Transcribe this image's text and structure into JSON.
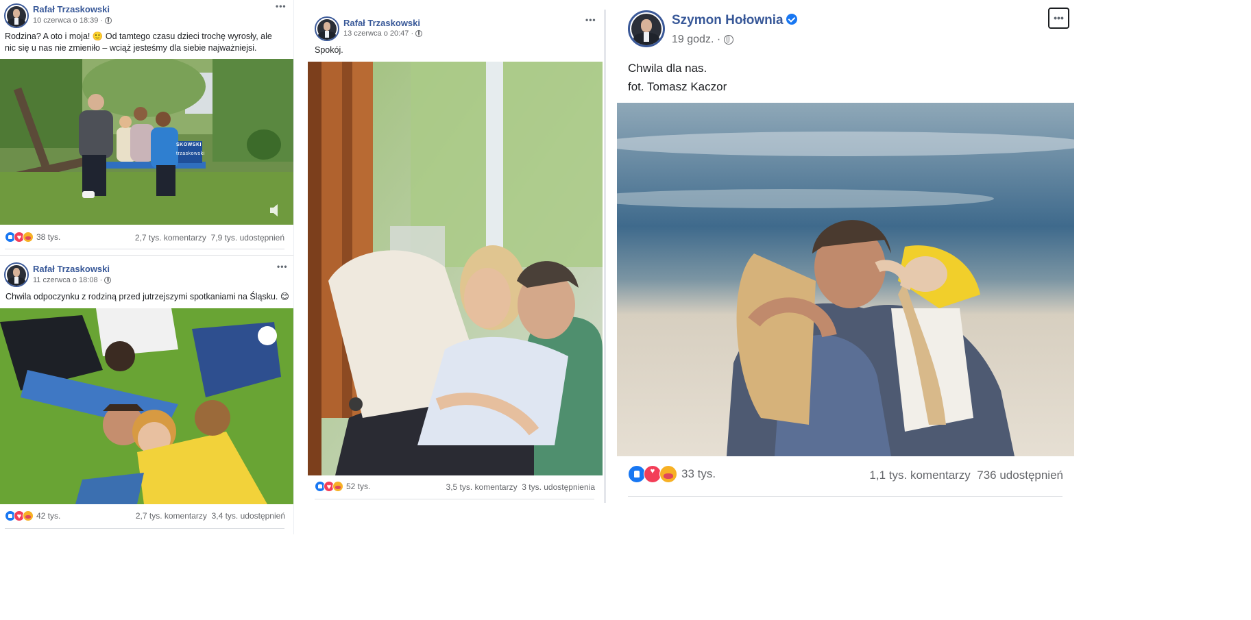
{
  "posts": [
    {
      "author": "Rafał Trzaskowski",
      "timestamp": "10 czerwca o 18:39 ·",
      "text": "Rodzina? A oto i moja! 🙂 Od tamtego czasu dzieci trochę wyrosły, ale nic się u nas nie zmieniło – wciąż jesteśmy dla siebie najważniejsi.",
      "reactions_count": "38 tys.",
      "comments": "2,7 tys. komentarzy",
      "shares": "7,9 tys. udostępnień",
      "photo_banner": "SKOWSKI",
      "photo_banner2": "trzaskowski"
    },
    {
      "author": "Rafał Trzaskowski",
      "timestamp": "11 czerwca o 18:08 ·",
      "text": "Chwila odpoczynku z rodziną przed jutrzejszymi spotkaniami na Śląsku. 😊",
      "reactions_count": "42 tys.",
      "comments": "2,7 tys. komentarzy",
      "shares": "3,4 tys. udostępnień"
    },
    {
      "author": "Rafał Trzaskowski",
      "timestamp": "13 czerwca o 20:47 ·",
      "text": "Spokój.",
      "reactions_count": "52 tys.",
      "comments": "3,5 tys. komentarzy",
      "shares": "3 tys. udostępnienia"
    },
    {
      "author": "Szymon Hołownia",
      "timestamp": "19 godz. ·",
      "text_line1": "Chwila dla nas.",
      "text_line2": "fot. Tomasz Kaczor",
      "reactions_count": "33 tys.",
      "comments": "1,1 tys. komentarzy",
      "shares": "736 udostępnień"
    }
  ],
  "more_glyph": "•••",
  "icons": {
    "privacy": "globe-icon",
    "more": "more-options-icon",
    "verified": "verified-badge-icon",
    "sound": "speaker-icon",
    "reactions": [
      "like-reaction-icon",
      "love-reaction-icon",
      "care-reaction-icon"
    ]
  },
  "colors": {
    "name_blue": "#385898",
    "meta_gray": "#65676b",
    "like": "#1877f2",
    "love": "#f33e58",
    "care": "#f7b125"
  }
}
